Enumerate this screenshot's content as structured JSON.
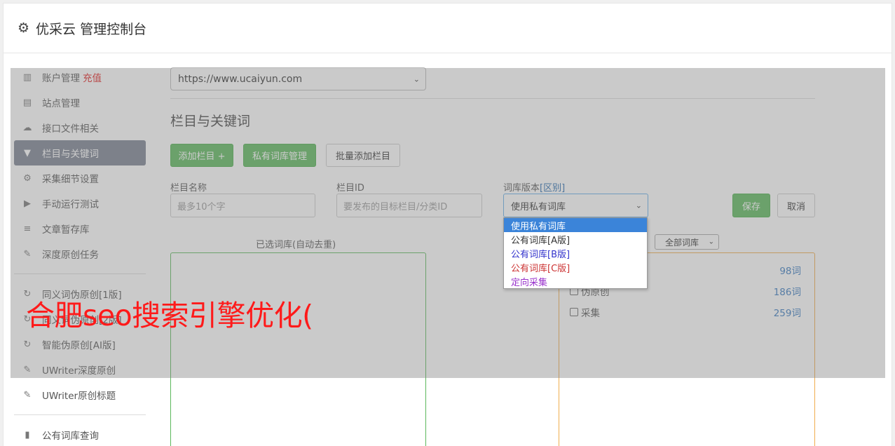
{
  "header": {
    "title": "优采云 管理控制台"
  },
  "sidebar": {
    "items": [
      {
        "label": "账户管理",
        "badge": "充值",
        "icon": "bar-chart-icon"
      },
      {
        "label": "站点管理",
        "icon": "server-icon"
      },
      {
        "label": "接口文件相关",
        "icon": "cloud-upload-icon"
      },
      {
        "label": "栏目与关键词",
        "icon": "filter-icon",
        "active": true
      },
      {
        "label": "采集细节设置",
        "icon": "cogs-icon"
      },
      {
        "label": "手动运行测试",
        "icon": "play-circle-icon"
      },
      {
        "label": "文章暂存库",
        "icon": "database-icon"
      },
      {
        "label": "深度原创任务",
        "icon": "edit-icon"
      }
    ],
    "items2": [
      {
        "label": "同义词伪原创[1版]",
        "icon": "refresh-icon"
      },
      {
        "label": "同义词伪原创[2版]",
        "icon": "refresh-icon"
      },
      {
        "label": "智能伪原创[AI版]",
        "icon": "refresh-icon"
      },
      {
        "label": "UWriter深度原创",
        "icon": "edit-icon"
      },
      {
        "label": "UWriter原创标题",
        "icon": "edit-icon"
      }
    ],
    "items3": [
      {
        "label": "公有词库查询",
        "icon": "book-icon"
      }
    ]
  },
  "main": {
    "site_select": "https://www.ucaiyun.com",
    "section_title": "栏目与关键词",
    "buttons": {
      "add_column": "添加栏目 +",
      "private_lib": "私有词库管理",
      "batch_add": "批量添加栏目"
    },
    "form": {
      "name_label": "栏目名称",
      "name_placeholder": "最多10个字",
      "id_label": "栏目ID",
      "id_placeholder": "要发布的目标栏目/分类ID",
      "version_label": "词库版本",
      "version_link": "[区别]",
      "version_value": "使用私有词库",
      "save": "保存",
      "cancel": "取消"
    },
    "dropdown_options": [
      {
        "label": "使用私有词库",
        "color": "#ffffff",
        "selected": true
      },
      {
        "label": "公有词库[A版]",
        "color": "#333333"
      },
      {
        "label": "公有词库[B版]",
        "color": "#3333cc"
      },
      {
        "label": "公有词库[C版]",
        "color": "#cc3333"
      },
      {
        "label": "定向采集",
        "color": "#9933cc"
      }
    ],
    "selected_lib_title": "已选词库(自动去重)",
    "lib_filter": "全部词库",
    "libs": [
      {
        "label": "",
        "count": "98词"
      },
      {
        "label": "伪原创",
        "count": "186词"
      },
      {
        "label": "采集",
        "count": "259词"
      }
    ]
  },
  "watermark": "合肥seo搜索引擎优化("
}
